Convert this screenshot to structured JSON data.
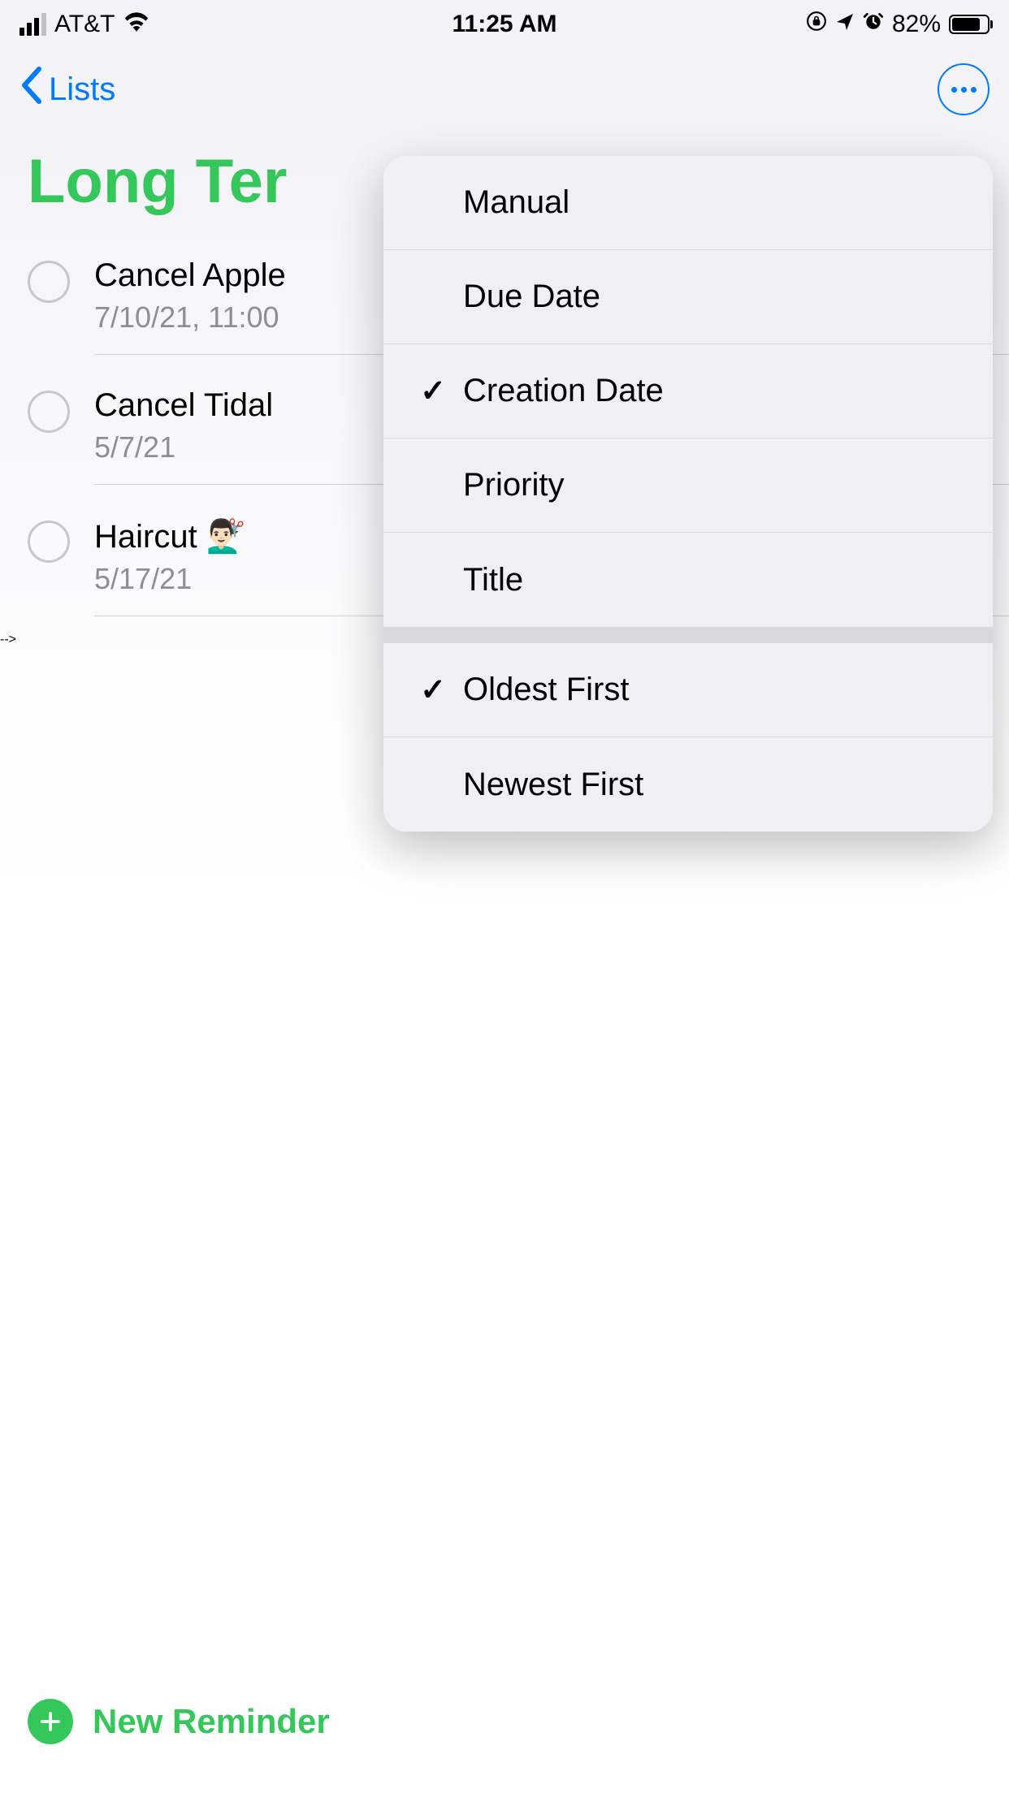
{
  "statusBar": {
    "carrier": "AT&T",
    "time": "11:25 AM",
    "batteryPercent": "82%"
  },
  "nav": {
    "backLabel": "Lists"
  },
  "page": {
    "title": "Long Ter"
  },
  "reminders": [
    {
      "title": "Cancel Apple",
      "date": "7/10/21, 11:00"
    },
    {
      "title": "Cancel Tidal",
      "date": "5/7/21"
    },
    {
      "title": "Haircut 💇🏻‍♂️",
      "date": "5/17/21"
    }
  ],
  "sortMenu": {
    "sortOptions": [
      {
        "label": "Manual",
        "checked": false
      },
      {
        "label": "Due Date",
        "checked": false
      },
      {
        "label": "Creation Date",
        "checked": true
      },
      {
        "label": "Priority",
        "checked": false
      },
      {
        "label": "Title",
        "checked": false
      }
    ],
    "orderOptions": [
      {
        "label": "Oldest First",
        "checked": true
      },
      {
        "label": "Newest First",
        "checked": false
      }
    ]
  },
  "bottom": {
    "newReminderLabel": "New Reminder"
  }
}
